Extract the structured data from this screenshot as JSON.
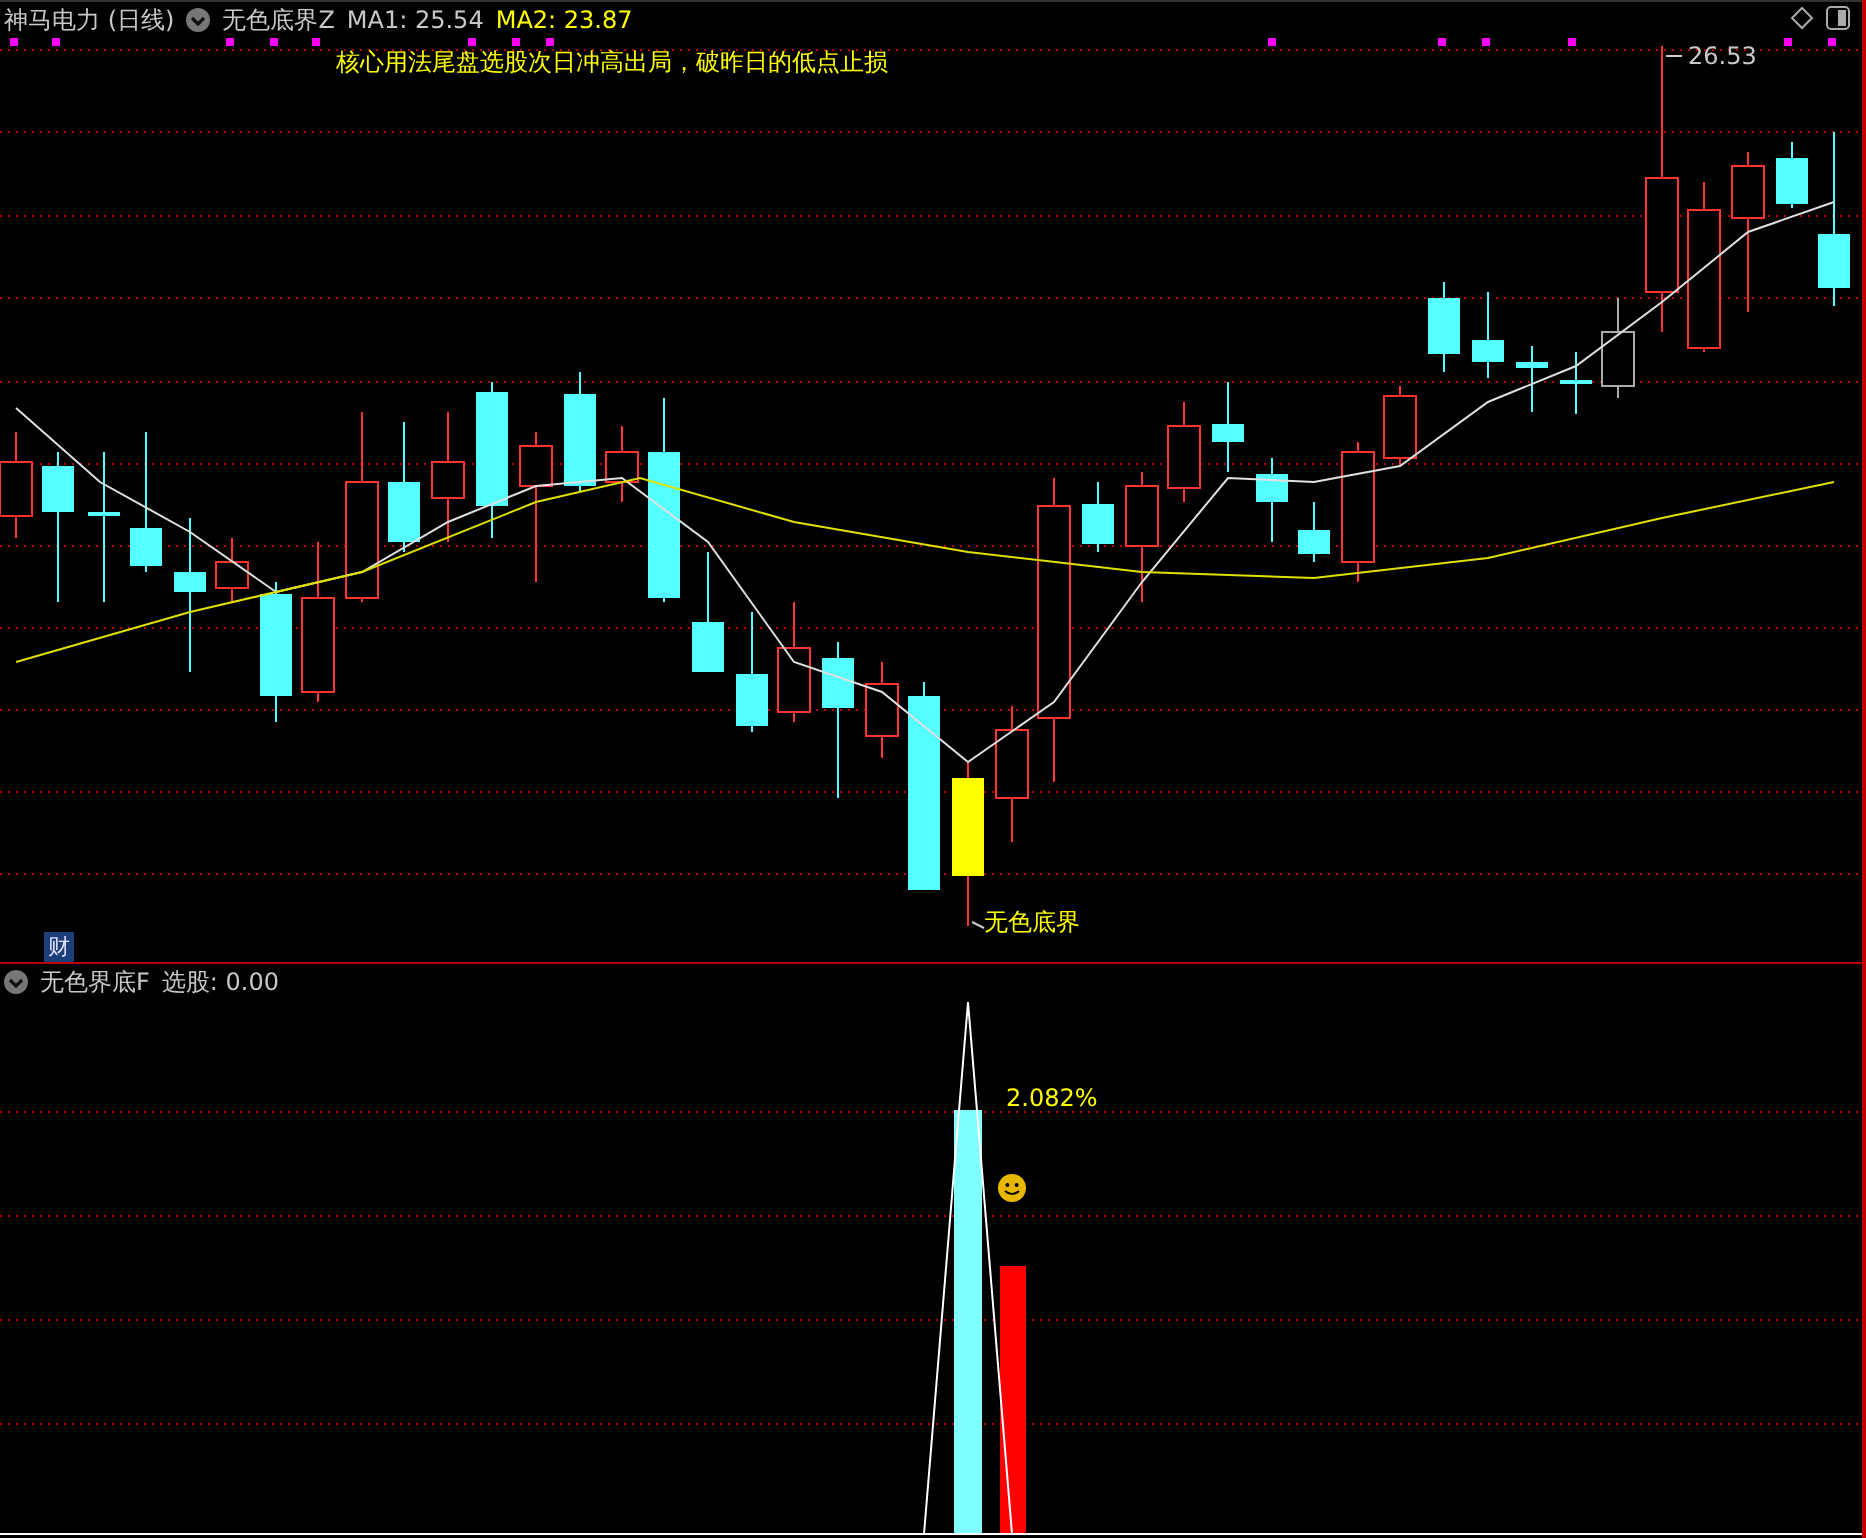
{
  "header": {
    "stock": "神马电力 (日线)",
    "indicator": "无色底界Z",
    "ma1": "MA1: 25.54",
    "ma2": "MA2: 23.87"
  },
  "main_chart": {
    "note": "核心用法尾盘选股次日冲高出局，破昨日的低点止损",
    "peak_label": "26.53",
    "signal_label": "无色底界",
    "badge": "财"
  },
  "lower_panel": {
    "indicator": "无色界底F",
    "value": "选股: 0.00",
    "percent_label": "2.082%"
  }
}
